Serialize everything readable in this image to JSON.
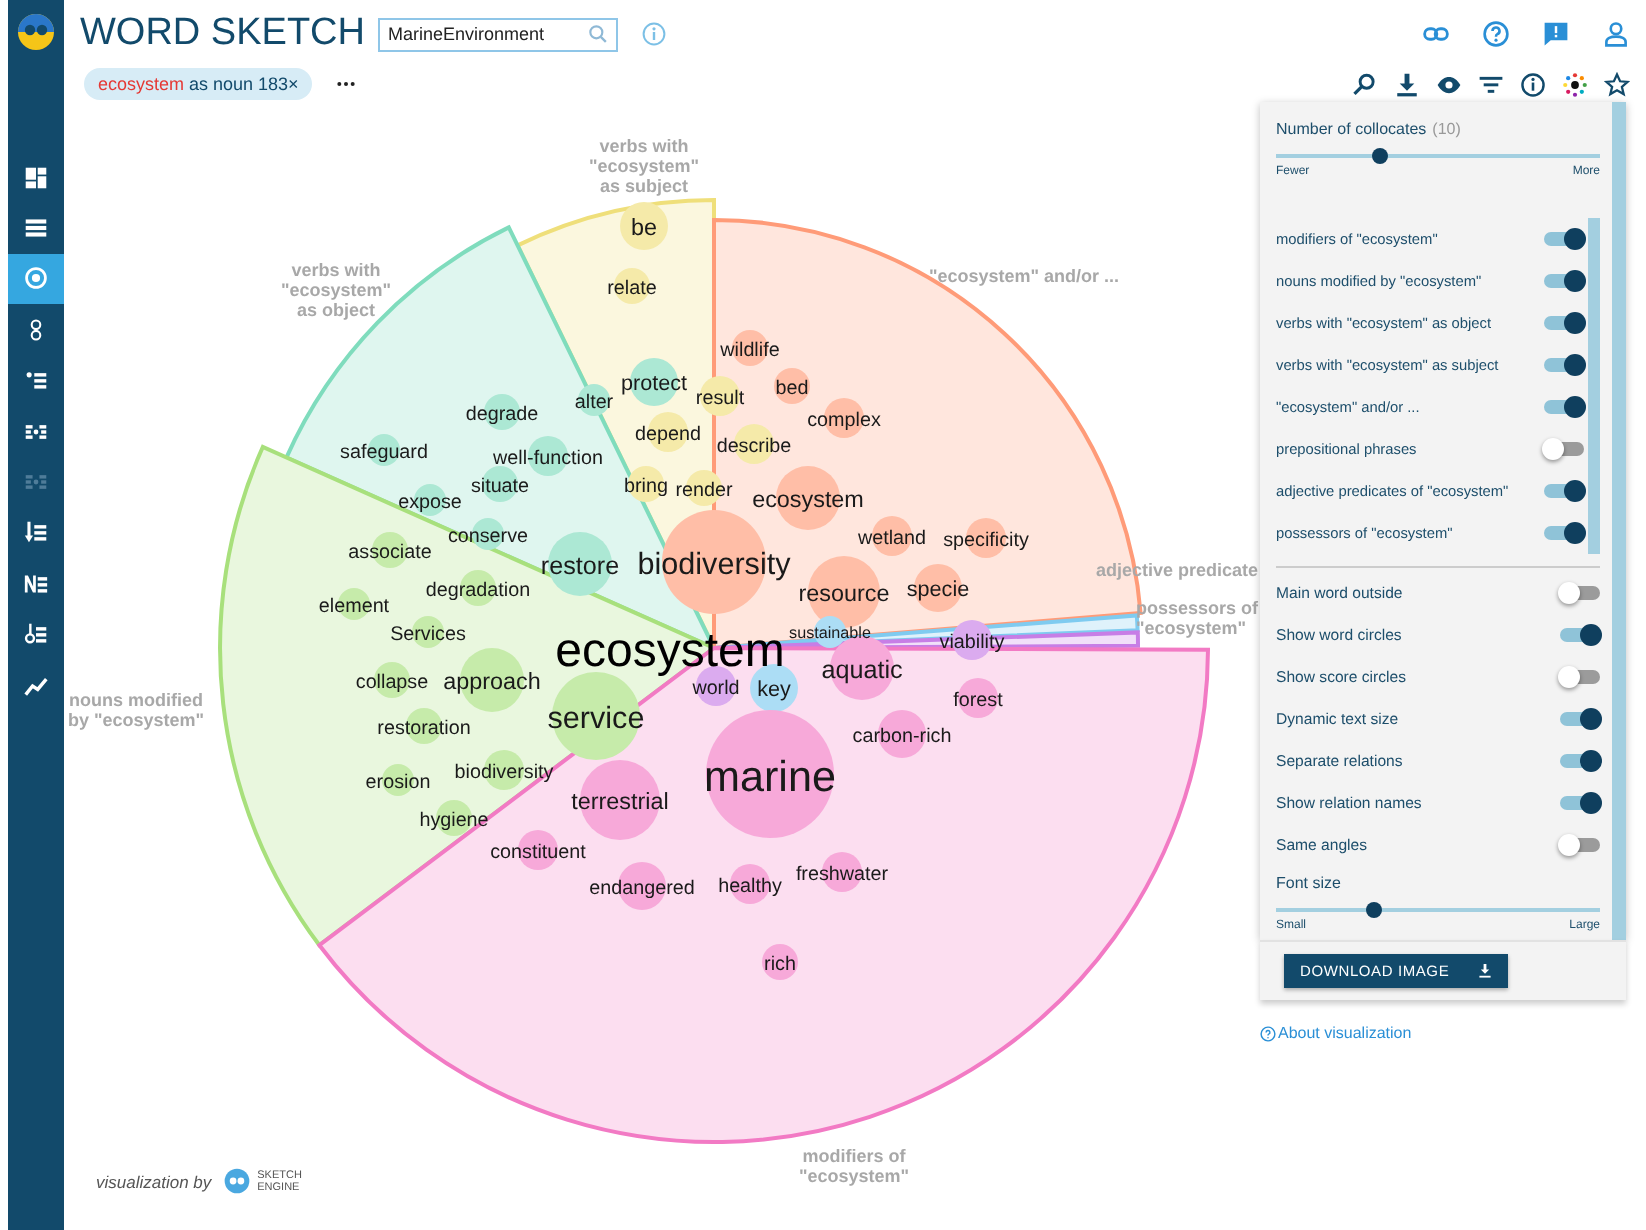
{
  "app": {
    "title": "WORD SKETCH"
  },
  "search": {
    "value": "MarineEnvironment"
  },
  "query_chip": {
    "word": "ecosystem",
    "text": "as noun 183×"
  },
  "sidebar": {
    "items": [
      {
        "kind": "dashboard",
        "selected": false,
        "disabled": false
      },
      {
        "kind": "list",
        "selected": false,
        "disabled": false
      },
      {
        "kind": "target",
        "selected": true,
        "disabled": false
      },
      {
        "kind": "pair",
        "selected": false,
        "disabled": false
      },
      {
        "kind": "dot-list",
        "selected": false,
        "disabled": false
      },
      {
        "kind": "dot-grid",
        "selected": false,
        "disabled": false
      },
      {
        "kind": "dot-grid",
        "selected": false,
        "disabled": true
      },
      {
        "kind": "sort-list",
        "selected": false,
        "disabled": false
      },
      {
        "kind": "n-list",
        "selected": false,
        "disabled": false
      },
      {
        "kind": "key-list",
        "selected": false,
        "disabled": false
      },
      {
        "kind": "trend",
        "selected": false,
        "disabled": false
      }
    ]
  },
  "sketch": {
    "headword": "ecosystem",
    "relations": [
      {
        "label_lines": [
          "verbs with",
          "\"ecosystem\"",
          "as subject"
        ],
        "color": "#efdf7a",
        "words": [
          "be",
          "relate",
          "result",
          "depend",
          "describe",
          "bring",
          "render"
        ]
      },
      {
        "label_lines": [
          "verbs with",
          "\"ecosystem\"",
          "as object"
        ],
        "color": "#7fdcbd",
        "words": [
          "protect",
          "alter",
          "degrade",
          "safeguard",
          "well-function",
          "situate",
          "expose",
          "conserve",
          "restore"
        ]
      },
      {
        "label_lines": [
          "\"ecosystem\" and/or ..."
        ],
        "color": "#ff9b78",
        "words": [
          "wildlife",
          "bed",
          "complex",
          "ecosystem",
          "biodiversity",
          "wetland",
          "specificity",
          "resource",
          "specie"
        ]
      },
      {
        "label_lines": [
          "nouns modified",
          "by \"ecosystem\""
        ],
        "color": "#a8e07c",
        "words": [
          "associate",
          "element",
          "degradation",
          "Services",
          "collapse",
          "approach",
          "restoration",
          "service",
          "biodiversity",
          "erosion",
          "hygiene"
        ]
      },
      {
        "label_lines": [
          "adjective predicate"
        ],
        "color": "#7fcbf0",
        "words": [
          "sustainable",
          "key"
        ]
      },
      {
        "label_lines": [
          "possessors of",
          "\"ecosystem\""
        ],
        "color": "#c77ee6",
        "words": [
          "world",
          "viability"
        ]
      },
      {
        "label_lines": [
          "modifiers of",
          "\"ecosystem\""
        ],
        "color": "#f27ac4",
        "words": [
          "aquatic",
          "forest",
          "carbon-rich",
          "marine",
          "terrestrial",
          "constituent",
          "endangered",
          "healthy",
          "freshwater",
          "rich"
        ]
      }
    ]
  },
  "panel": {
    "collocates": {
      "label": "Number of collocates",
      "count": "(10)",
      "level": 0.32,
      "min_label": "Fewer",
      "max_label": "More"
    },
    "relations": [
      {
        "label": "modifiers of \"ecosystem\"",
        "on": true
      },
      {
        "label": "nouns modified by \"ecosystem\"",
        "on": true
      },
      {
        "label": "verbs with \"ecosystem\" as object",
        "on": true
      },
      {
        "label": "verbs with \"ecosystem\" as subject",
        "on": true
      },
      {
        "label": "\"ecosystem\" and/or ...",
        "on": true
      },
      {
        "label": "prepositional phrases",
        "on": false
      },
      {
        "label": "adjective predicates of \"ecosystem\"",
        "on": true
      },
      {
        "label": "possessors of \"ecosystem\"",
        "on": true
      }
    ],
    "options": [
      {
        "label": "Main word outside",
        "on": false
      },
      {
        "label": "Show word circles",
        "on": true
      },
      {
        "label": "Show score circles",
        "on": false
      },
      {
        "label": "Dynamic text size",
        "on": true
      },
      {
        "label": "Separate relations",
        "on": true
      },
      {
        "label": "Show relation names",
        "on": true
      },
      {
        "label": "Same angles",
        "on": false
      }
    ],
    "font_size": {
      "label": "Font size",
      "level": 0.3,
      "min_label": "Small",
      "max_label": "Large"
    },
    "download_button": "DOWNLOAD IMAGE"
  },
  "about_link": "About visualization",
  "credit": {
    "text": "visualization by",
    "brand_lines": [
      "SKETCH",
      "ENGINE"
    ]
  }
}
